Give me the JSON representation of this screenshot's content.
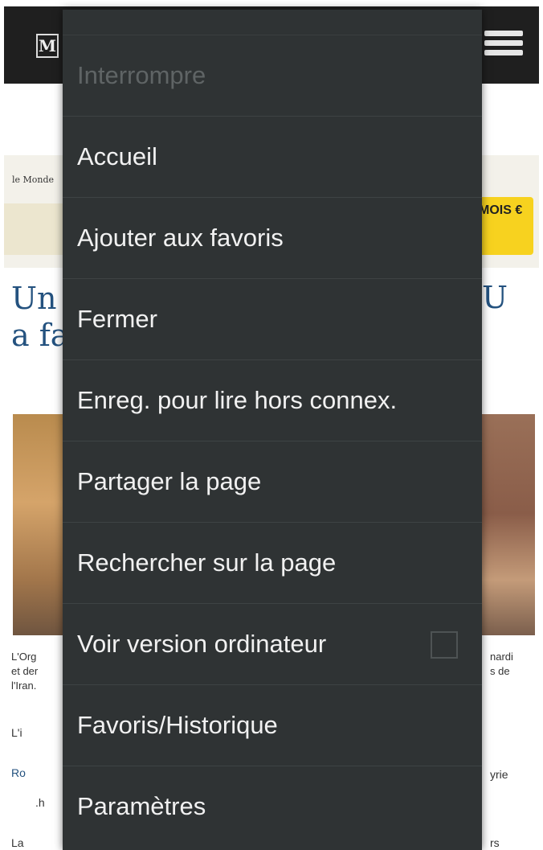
{
  "background_page": {
    "logo_letter": "M",
    "banner_mark": "le Monde",
    "promo_text": "MOIS €",
    "headline_lines": [
      "Un",
      "a fa"
    ],
    "headline_right": "U",
    "caption_left": [
      "L'Org",
      "et der",
      "l'Iran."
    ],
    "caption_right": [
      "nardi",
      "s de"
    ],
    "bullets": [
      {
        "text": "L'i",
        "link": false
      },
      {
        "text": "Ro",
        "link": true
      },
      {
        "text": ".h",
        "link": false
      },
      {
        "text": "La",
        "link": false
      }
    ],
    "bullet_right": [
      "yrie",
      "rs"
    ]
  },
  "menu": {
    "items": [
      {
        "label": "Interrompre",
        "disabled": true
      },
      {
        "label": "Accueil",
        "disabled": false
      },
      {
        "label": "Ajouter aux favoris",
        "disabled": false
      },
      {
        "label": "Fermer",
        "disabled": false
      },
      {
        "label": "Enreg. pour lire hors connex.",
        "disabled": false
      },
      {
        "label": "Partager la page",
        "disabled": false
      },
      {
        "label": "Rechercher sur la page",
        "disabled": false
      },
      {
        "label": "Voir version ordinateur",
        "disabled": false,
        "checkbox": false
      },
      {
        "label": "Favoris/Historique",
        "disabled": false
      },
      {
        "label": "Paramètres",
        "disabled": false
      }
    ]
  },
  "colors": {
    "menu_background": "#2f3334",
    "menu_text": "#f1f1f1",
    "menu_text_disabled": "#5f6465",
    "headline_blue": "#24527f",
    "promo_yellow": "#f7d21f"
  }
}
